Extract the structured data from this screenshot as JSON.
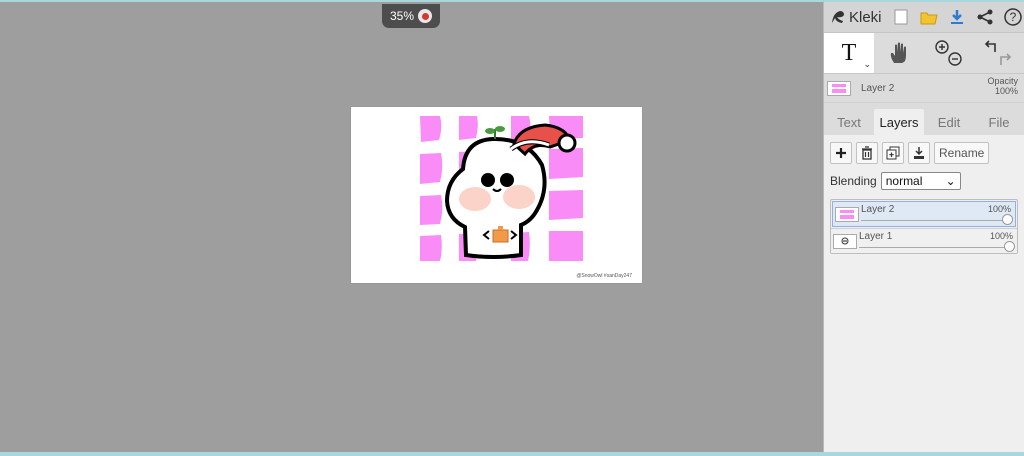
{
  "canvas": {
    "zoom_label": "35%",
    "watermark": "@SnowOwl #sanDay247"
  },
  "app": {
    "name": "Kleki"
  },
  "toolbar": {
    "icons": [
      "new-file-icon",
      "open-folder-icon",
      "download-icon",
      "share-icon",
      "help-icon"
    ],
    "tools": [
      "text-tool-icon",
      "hand-tool-icon",
      "zoom-in-icon",
      "zoom-out-icon",
      "undo-icon",
      "redo-icon"
    ],
    "text_tool_glyph": "T"
  },
  "current_layer": {
    "name": "Layer 2",
    "opacity_label": "Opacity",
    "opacity_value": "100%"
  },
  "tabs": [
    {
      "label": "Text"
    },
    {
      "label": "Layers"
    },
    {
      "label": "Edit"
    },
    {
      "label": "File"
    }
  ],
  "layers_panel": {
    "rename_label": "Rename",
    "blending_label": "Blending",
    "blending_value": "normal",
    "layers": [
      {
        "name": "Layer 2",
        "opacity": "100%"
      },
      {
        "name": "Layer 1",
        "opacity": "100%"
      }
    ]
  },
  "colors": {
    "accent": "#2a7bd3",
    "pink": "#fa8cf7",
    "hat_red": "#e8504a"
  }
}
